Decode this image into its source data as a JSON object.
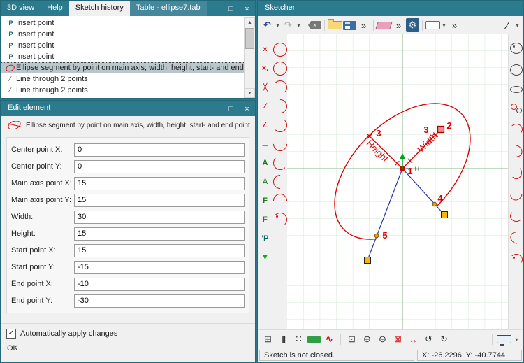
{
  "colors": {
    "titlebar": "#2b7a8e",
    "accent_red": "#dd0000",
    "axis_green": "#85b885",
    "line_blue": "#2233aa",
    "marker_yellow": "#f6b700"
  },
  "chrome": {
    "maximize_glyph": "□",
    "close_glyph": "×",
    "scroll_up_glyph": "▲",
    "scroll_down_glyph": "▼"
  },
  "history_window": {
    "tabs": [
      {
        "name": "tab-3d-view",
        "label": "3D view",
        "cls": "",
        "inter": "true"
      },
      {
        "name": "tab-help",
        "label": "Help",
        "cls": "",
        "inter": "true"
      },
      {
        "name": "tab-sketch-history",
        "label": "Sketch history",
        "cls": "active",
        "inter": "true"
      },
      {
        "name": "tab-table-ellipse7",
        "label": "Table - ellipse7.tab",
        "cls": "alt",
        "inter": "true"
      }
    ],
    "items": [
      {
        "name": "history-item-insert-point-1",
        "icls": "ic-point",
        "label": "Insert point",
        "cls": ""
      },
      {
        "name": "history-item-insert-point-2",
        "icls": "ic-point",
        "label": "Insert point",
        "cls": ""
      },
      {
        "name": "history-item-insert-point-3",
        "icls": "ic-point",
        "label": "Insert point",
        "cls": ""
      },
      {
        "name": "history-item-insert-point-4",
        "icls": "ic-point",
        "label": "Insert point",
        "cls": ""
      },
      {
        "name": "history-item-ellipse-segment",
        "icls": "ic-ellipse",
        "label": "Ellipse segment by point on main axis, width, height, start- and end point",
        "cls": "selected"
      },
      {
        "name": "history-item-line-1",
        "icls": "ic-line",
        "label": "Line through 2 points",
        "cls": ""
      },
      {
        "name": "history-item-line-2",
        "icls": "ic-line",
        "label": "Line through 2 points",
        "cls": ""
      }
    ]
  },
  "edit_window": {
    "title": "Edit element",
    "header": "Ellipse segment by point on main axis, width, height, start- and end point",
    "fields": [
      {
        "name": "center-point-x-input",
        "label": "Center point X:",
        "value": "0"
      },
      {
        "name": "center-point-y-input",
        "label": "Center point Y:",
        "value": "0"
      },
      {
        "name": "main-axis-point-x-input",
        "label": "Main axis point X:",
        "value": "15"
      },
      {
        "name": "main-axis-point-y-input",
        "label": "Main axis point Y:",
        "value": "15"
      },
      {
        "name": "width-input",
        "label": "Width:",
        "value": "30"
      },
      {
        "name": "height-input",
        "label": "Height:",
        "value": "15"
      },
      {
        "name": "start-point-x-input",
        "label": "Start point X:",
        "value": "15"
      },
      {
        "name": "start-point-y-input",
        "label": "Start point Y:",
        "value": "-15"
      },
      {
        "name": "end-point-x-input",
        "label": "End point X:",
        "value": "-10"
      },
      {
        "name": "end-point-y-input",
        "label": "End point Y:",
        "value": "-30"
      }
    ],
    "checkbox_label": "Automatically apply changes",
    "check_glyph": "✓",
    "ok_label": "OK"
  },
  "sketcher": {
    "title": "Sketcher",
    "top_toolbar": [
      {
        "name": "undo-button",
        "glyph": "↶",
        "cls": "c-undo b"
      },
      {
        "name": "undo-dropdown",
        "glyph": "▾",
        "cls": "dd"
      },
      {
        "name": "redo-button",
        "glyph": "↷",
        "cls": "c-gray b"
      },
      {
        "name": "redo-dropdown",
        "glyph": "▾",
        "cls": "dd c-gray"
      },
      {
        "name": "separator",
        "cls": "sep",
        "inter": "false"
      },
      {
        "name": "delete-button",
        "glyph": "×",
        "cls": "shape-backspace"
      },
      {
        "name": "separator",
        "cls": "sep",
        "inter": "false"
      },
      {
        "name": "open-button",
        "cls": "shape-folder"
      },
      {
        "name": "save-button",
        "cls": "shape-floppy"
      },
      {
        "name": "more-file-tools-button",
        "glyph": "»",
        "cls": "c-dark"
      },
      {
        "name": "separator",
        "cls": "sep",
        "inter": "false"
      },
      {
        "name": "eraser-button",
        "cls": "shape-eraser"
      },
      {
        "name": "more-edit-tools-button",
        "glyph": "»",
        "cls": "c-dark"
      },
      {
        "name": "settings-button",
        "glyph": "⚙",
        "cls": "pressed"
      },
      {
        "name": "separator",
        "cls": "sep",
        "inter": "false"
      },
      {
        "name": "selection-button",
        "cls": "shape-rect"
      },
      {
        "name": "selection-dropdown",
        "glyph": "▾",
        "cls": "dd"
      },
      {
        "name": "more-selection-tools-button",
        "glyph": "»",
        "cls": "c-dark"
      },
      {
        "name": "separator",
        "cls": "sep push",
        "inter": "false"
      },
      {
        "name": "line-style-button",
        "glyph": "∕",
        "cls": "c-dark b"
      },
      {
        "name": "line-style-dropdown",
        "glyph": "▾",
        "cls": "dd"
      }
    ],
    "left_toolbar": [
      {
        "name": "point-tool-icon",
        "glyph": "×",
        "cls": "c-red b"
      },
      {
        "name": "ellipse-tool-icon",
        "cls": "shape-ell"
      },
      {
        "name": "point-coordinates-tool-icon",
        "glyph": "×.",
        "cls": "c-red b"
      },
      {
        "name": "ellipse-rotated-tool-icon",
        "cls": "shape-ell alt"
      },
      {
        "name": "cross-lines-tool-icon",
        "glyph": "╳",
        "cls": "c-red"
      },
      {
        "name": "elliptic-arc-tool-icon",
        "cls": "shape-arc"
      },
      {
        "name": "line-tool-icon",
        "glyph": "∕",
        "cls": "c-red b"
      },
      {
        "name": "elliptic-arc-2-tool-icon",
        "cls": "shape-arc r45"
      },
      {
        "name": "angle-tool-icon",
        "glyph": "∠",
        "cls": "c-red"
      },
      {
        "name": "arc-tool-icon",
        "cls": "shape-arc r90"
      },
      {
        "name": "perpendicular-tool-icon",
        "glyph": "⊥",
        "cls": "c-red"
      },
      {
        "name": "arc-2-tool-icon",
        "cls": "shape-arc r135"
      },
      {
        "name": "label-tool-icon",
        "glyph": "A",
        "cls": "c-green b"
      },
      {
        "name": "arc-3-tool-icon",
        "cls": "shape-arc r180"
      },
      {
        "name": "label-2-tool-icon",
        "glyph": "A",
        "cls": "c-green"
      },
      {
        "name": "arc-4-tool-icon",
        "cls": "shape-arc r225"
      },
      {
        "name": "function-tool-icon",
        "glyph": "F",
        "cls": "c-green b"
      },
      {
        "name": "arc-5-tool-icon",
        "cls": "shape-arc r315"
      },
      {
        "name": "function-2-tool-icon",
        "glyph": "F",
        "cls": "c-green"
      },
      {
        "name": "arc-6-tool-icon",
        "cls": "shape-arc dot"
      },
      {
        "name": "insert-point-tool-icon",
        "glyph": "'P",
        "cls": "c-teal b"
      },
      {
        "name": "spacer",
        "cls": "blank",
        "inter": "false"
      },
      {
        "name": "apply-tool-icon",
        "glyph": "▼",
        "cls": "c-bright-green"
      },
      {
        "name": "spacer",
        "cls": "blank",
        "inter": "false"
      }
    ],
    "right_toolbar": [
      {
        "name": "circle-center-tool-icon",
        "cls": "shape-circ dot"
      },
      {
        "name": "circle-tool-icon",
        "cls": "shape-circ"
      },
      {
        "name": "circle-2-tool-icon",
        "cls": "shape-circ sm"
      },
      {
        "name": "two-circles-tool-icon",
        "cls": "shape-2circ"
      },
      {
        "name": "circular-arc-tool-icon",
        "cls": "shape-arc"
      },
      {
        "name": "circular-arc-2-tool-icon",
        "cls": "shape-arc r45"
      },
      {
        "name": "circular-arc-3-tool-icon",
        "cls": "shape-arc r90"
      },
      {
        "name": "circular-arc-4-tool-icon",
        "cls": "shape-arc r135"
      },
      {
        "name": "circular-arc-5-tool-icon",
        "cls": "shape-arc r180"
      },
      {
        "name": "circular-arc-6-tool-icon",
        "cls": "shape-arc r225"
      },
      {
        "name": "circular-arc-7-tool-icon",
        "cls": "shape-arc dot"
      }
    ],
    "bottom_toolbar": [
      {
        "name": "grid-button",
        "glyph": "⊞",
        "cls": "c-dark"
      },
      {
        "name": "bars-button",
        "glyph": "|||",
        "cls": "c-dark tight"
      },
      {
        "name": "hatch-button",
        "glyph": "∷",
        "cls": "c-dark"
      },
      {
        "name": "plot-button",
        "cls": "shape-printer"
      },
      {
        "name": "curve-button",
        "glyph": "∿",
        "cls": "c-red b"
      },
      {
        "name": "separator",
        "cls": "sep",
        "inter": "false"
      },
      {
        "name": "zoom-window-button",
        "glyph": "⊡",
        "cls": "c-dark"
      },
      {
        "name": "zoom-in-button",
        "glyph": "⊕",
        "cls": "c-dark"
      },
      {
        "name": "zoom-out-button",
        "glyph": "⊖",
        "cls": "c-dark"
      },
      {
        "name": "zoom-extents-button",
        "glyph": "⊠",
        "cls": "c-red"
      },
      {
        "name": "pan-button",
        "glyph": "↔",
        "cls": "c-red"
      },
      {
        "name": "zoom-previous-button",
        "glyph": "↺",
        "cls": "c-dark"
      },
      {
        "name": "redraw-button",
        "glyph": "↻",
        "cls": "c-dark"
      },
      {
        "name": "separator",
        "cls": "sep push",
        "inter": "false"
      },
      {
        "name": "viewport-button",
        "cls": "shape-monitor"
      },
      {
        "name": "viewport-dropdown",
        "glyph": "▾",
        "cls": "dd"
      }
    ],
    "canvas": {
      "n1": "1",
      "n2": "2",
      "n3_width": "3",
      "n3_height": "3",
      "n4": "4",
      "n5": "5",
      "width_label": "Width",
      "height_label": "Height",
      "h_marker": "H"
    },
    "status_left": "Sketch is not closed.",
    "status_right": "X: -26.2296, Y: -40.7744"
  }
}
